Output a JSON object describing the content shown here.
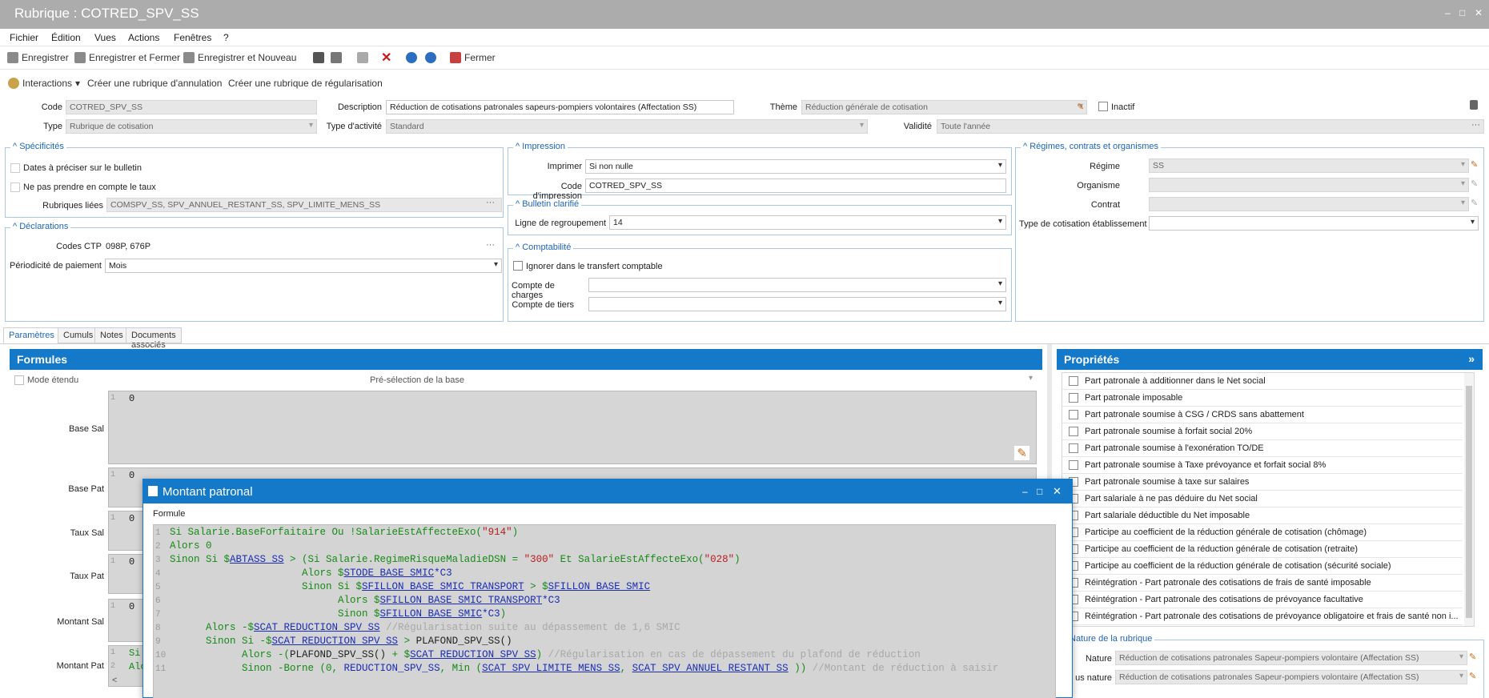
{
  "window": {
    "title": "Rubrique : COTRED_SPV_SS",
    "controls": [
      "–",
      "□",
      "✕"
    ]
  },
  "menu": [
    "Fichier",
    "Édition",
    "Vues",
    "Actions",
    "Fenêtres",
    "?"
  ],
  "toolbar": {
    "save": "Enregistrer",
    "save_close": "Enregistrer et Fermer",
    "save_new": "Enregistrer et Nouveau",
    "close": "Fermer"
  },
  "toolbar2": {
    "interactions": "Interactions",
    "cancel_rubric": "Créer une rubrique d'annulation",
    "regul_rubric": "Créer une rubrique de régularisation"
  },
  "header": {
    "code_label": "Code",
    "code_value": "COTRED_SPV_SS",
    "desc_label": "Description",
    "desc_value": "Réduction de cotisations patronales sapeurs-pompiers volontaires (Affectation SS)",
    "theme_label": "Thème",
    "theme_value": "Réduction générale de cotisation",
    "inactive_label": "Inactif",
    "type_label": "Type",
    "type_value": "Rubrique de cotisation",
    "activity_label": "Type d'activité",
    "activity_value": "Standard",
    "validity_label": "Validité",
    "validity_value": "Toute l'année"
  },
  "specificites": {
    "title": "Spécificités",
    "dates_label": "Dates à préciser sur le bulletin",
    "taux_label": "Ne pas prendre en compte le taux",
    "linked_label": "Rubriques liées",
    "linked_value": "COMSPV_SS, SPV_ANNUEL_RESTANT_SS, SPV_LIMITE_MENS_SS"
  },
  "declarations": {
    "title": "Déclarations",
    "ctp_label": "Codes CTP",
    "ctp_value": "098P, 676P",
    "period_label": "Périodicité de paiement",
    "period_value": "Mois"
  },
  "impression": {
    "title": "Impression",
    "print_label": "Imprimer",
    "print_value": "Si non nulle",
    "code_label": "Code d'impression",
    "code_value": "COTRED_SPV_SS"
  },
  "bulletin": {
    "title": "Bulletin clarifié",
    "line_label": "Ligne de regroupement",
    "line_value": "14"
  },
  "comptabilite": {
    "title": "Comptabilité",
    "ignore_label": "Ignorer dans le transfert comptable",
    "charges_label": "Compte de charges",
    "tiers_label": "Compte de tiers"
  },
  "regimes": {
    "title": "Régimes, contrats et organismes",
    "regime_label": "Régime",
    "regime_value": "SS",
    "org_label": "Organisme",
    "contract_label": "Contrat",
    "type_label": "Type de cotisation établissement"
  },
  "tabs": [
    "Paramètres",
    "Cumuls",
    "Notes",
    "Documents associés"
  ],
  "formules": {
    "title": "Formules",
    "mode_label": "Mode étendu",
    "presel_label": "Pré-sélection de la base",
    "rows": [
      {
        "label": "Base Sal",
        "value": "0"
      },
      {
        "label": "Base Pat",
        "value": "0"
      },
      {
        "label": "Taux Sal",
        "value": "0"
      },
      {
        "label": "Taux Pat",
        "value": "0"
      },
      {
        "label": "Montant Sal",
        "value": "0"
      },
      {
        "label": "Montant Pat",
        "value": "Si"
      }
    ],
    "montant_pat_line2": "Alo"
  },
  "proprietes": {
    "title": "Propriétés",
    "items": [
      "Part patronale à additionner dans le Net social",
      "Part patronale imposable",
      "Part patronale soumise à CSG / CRDS sans abattement",
      "Part patronale soumise à forfait social 20%",
      "Part patronale soumise à l'exonération TO/DE",
      "Part patronale soumise à Taxe prévoyance et forfait social 8%",
      "Part patronale soumise à taxe sur salaires",
      "Part salariale à ne pas déduire du Net social",
      "Part salariale déductible du Net imposable",
      "Participe au coefficient de la réduction générale de cotisation (chômage)",
      "Participe au coefficient de la réduction générale de cotisation (retraite)",
      "Participe au coefficient de la réduction générale de cotisation (sécurité sociale)",
      "Réintégration - Part patronale des cotisations de frais de santé imposable",
      "Réintégration - Part patronale des cotisations de prévoyance facultative",
      "Réintégration - Part patronale des cotisations de prévoyance obligatoire et frais de santé non i..."
    ],
    "nature_title": "Nature de la rubrique",
    "nature_label": "Nature",
    "nature_value": "Réduction de cotisations patronales Sapeur-pompiers volontaire (Affectation SS)",
    "sous_label": "us nature",
    "sous_value": "Réduction de cotisations patronales Sapeur-pompiers volontaire (Affectation SS)"
  },
  "modal": {
    "title": "Montant patronal",
    "field_label": "Formule",
    "lines": [
      "1",
      "2",
      "3",
      "4",
      "5",
      "6",
      "7",
      "8",
      "9",
      "10",
      "11"
    ]
  }
}
